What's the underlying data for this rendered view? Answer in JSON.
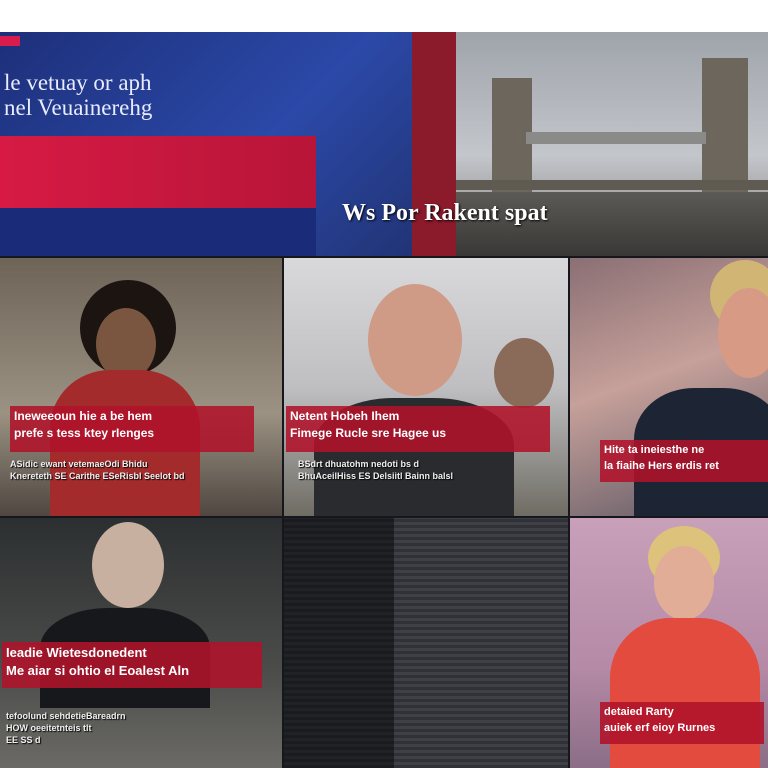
{
  "nav": {
    "items": [
      "",
      "",
      "",
      "",
      "",
      "",
      "",
      "",
      "",
      ""
    ]
  },
  "hero": {
    "title_line1": "le vetuay or aph",
    "title_line2": "nel Veuainerehg",
    "small_lines": [
      "",
      "",
      "",
      "",
      "",
      ""
    ]
  },
  "landmark": {
    "headline": "Ws Por Rakent spat",
    "sub": ""
  },
  "stories": [
    {
      "caption": [
        "Ineweeoun hie a be hem",
        "prefe s tess ktey rIenges"
      ],
      "sub": [
        "ASidic ewant vetemaeOdi Bhidu",
        "Knereteth SE Carithe ESeRisbl Seelot bd"
      ]
    },
    {
      "caption": [
        "Netent Hobeh Ihem",
        "Fimege Rucle sre Hagee us"
      ],
      "sub": [
        "BSdrt dhuatohm nedoti bs d",
        "BhuAceilHiss ES Delsiitl Bainn balsl"
      ]
    },
    {
      "caption": [
        "Hite ta ineiesthe ne",
        "la fiaihe Hers erdis ret"
      ],
      "sub": []
    },
    {
      "caption": [
        "Ieadie Wietesdonedent",
        "Me aiar si ohtio el Eoalest Aln"
      ],
      "sub": [
        "tefoolund sehdetieBareadrn",
        "HOW oeeitetnteis tlt",
        "EE SS d"
      ]
    },
    {
      "caption": [
        "detaied Rarty",
        "auiek erf eioy Rurnes"
      ],
      "sub": []
    }
  ]
}
